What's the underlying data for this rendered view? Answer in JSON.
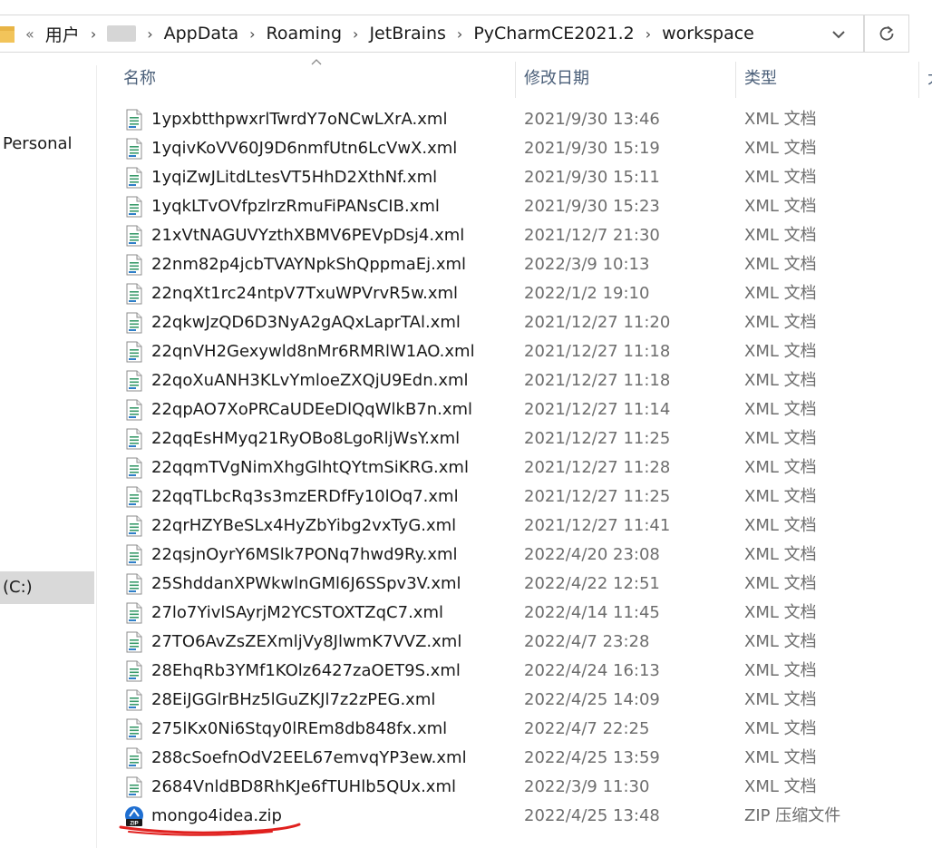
{
  "address_bar": {
    "overflow": "«",
    "crumbs": [
      "用户",
      "AppData",
      "Roaming",
      "JetBrains",
      "PyCharmCE2021.2",
      "workspace"
    ]
  },
  "nav": {
    "personal_label": "Personal",
    "drive_label": "(C:)"
  },
  "columns": {
    "name": "名称",
    "date": "修改日期",
    "type": "类型",
    "size": "大"
  },
  "files": [
    {
      "name": "1ypxbtthpwxrlTwrdY7oNCwLXrA.xml",
      "date": "2021/9/30 13:46",
      "type": "XML 文档",
      "icon": "xml-file-icon"
    },
    {
      "name": "1yqivKoVV60J9D6nmfUtn6LcVwX.xml",
      "date": "2021/9/30 15:19",
      "type": "XML 文档",
      "icon": "xml-file-icon"
    },
    {
      "name": "1yqiZwJLitdLtesVT5HhD2XthNf.xml",
      "date": "2021/9/30 15:11",
      "type": "XML 文档",
      "icon": "xml-file-icon"
    },
    {
      "name": "1yqkLTvOVfpzlrzRmuFiPANsCIB.xml",
      "date": "2021/9/30 15:23",
      "type": "XML 文档",
      "icon": "xml-file-icon"
    },
    {
      "name": "21xVtNAGUVYzthXBMV6PEVpDsj4.xml",
      "date": "2021/12/7 21:30",
      "type": "XML 文档",
      "icon": "xml-file-icon"
    },
    {
      "name": "22nm82p4jcbTVAYNpkShQppmaEj.xml",
      "date": "2022/3/9 10:13",
      "type": "XML 文档",
      "icon": "xml-file-icon"
    },
    {
      "name": "22nqXt1rc24ntpV7TxuWPVrvR5w.xml",
      "date": "2022/1/2 19:10",
      "type": "XML 文档",
      "icon": "xml-file-icon"
    },
    {
      "name": "22qkwJzQD6D3NyA2gAQxLaprTAl.xml",
      "date": "2021/12/27 11:20",
      "type": "XML 文档",
      "icon": "xml-file-icon"
    },
    {
      "name": "22qnVH2Gexywld8nMr6RMRlW1AO.xml",
      "date": "2021/12/27 11:18",
      "type": "XML 文档",
      "icon": "xml-file-icon"
    },
    {
      "name": "22qoXuANH3KLvYmloeZXQjU9Edn.xml",
      "date": "2021/12/27 11:18",
      "type": "XML 文档",
      "icon": "xml-file-icon"
    },
    {
      "name": "22qpAO7XoPRCaUDEeDlQqWlkB7n.xml",
      "date": "2021/12/27 11:14",
      "type": "XML 文档",
      "icon": "xml-file-icon"
    },
    {
      "name": "22qqEsHMyq21RyOBo8LgoRljWsY.xml",
      "date": "2021/12/27 11:25",
      "type": "XML 文档",
      "icon": "xml-file-icon"
    },
    {
      "name": "22qqmTVgNimXhgGlhtQYtmSiKRG.xml",
      "date": "2021/12/27 11:28",
      "type": "XML 文档",
      "icon": "xml-file-icon"
    },
    {
      "name": "22qqTLbcRq3s3mzERDfFy10lOq7.xml",
      "date": "2021/12/27 11:25",
      "type": "XML 文档",
      "icon": "xml-file-icon"
    },
    {
      "name": "22qrHZYBeSLx4HyZbYibg2vxTyG.xml",
      "date": "2021/12/27 11:41",
      "type": "XML 文档",
      "icon": "xml-file-icon"
    },
    {
      "name": "22qsjnOyrY6MSlk7PONq7hwd9Ry.xml",
      "date": "2022/4/20 23:08",
      "type": "XML 文档",
      "icon": "xml-file-icon"
    },
    {
      "name": "25ShddanXPWkwlnGMl6J6SSpv3V.xml",
      "date": "2022/4/22 12:51",
      "type": "XML 文档",
      "icon": "xml-file-icon"
    },
    {
      "name": "27lo7YivlSAyrjM2YCSTOXTZqC7.xml",
      "date": "2022/4/14 11:45",
      "type": "XML 文档",
      "icon": "xml-file-icon"
    },
    {
      "name": "27TO6AvZsZEXmljVy8JlwmK7VVZ.xml",
      "date": "2022/4/7 23:28",
      "type": "XML 文档",
      "icon": "xml-file-icon"
    },
    {
      "name": "28EhqRb3YMf1KOlz6427zaOET9S.xml",
      "date": "2022/4/24 16:13",
      "type": "XML 文档",
      "icon": "xml-file-icon"
    },
    {
      "name": "28EiJGGlrBHz5lGuZKJl7z2zPEG.xml",
      "date": "2022/4/25 14:09",
      "type": "XML 文档",
      "icon": "xml-file-icon"
    },
    {
      "name": "275lKx0Ni6Stqy0lREm8db848fx.xml",
      "date": "2022/4/7 22:25",
      "type": "XML 文档",
      "icon": "xml-file-icon"
    },
    {
      "name": "288cSoefnOdV2EEL67emvqYP3ew.xml",
      "date": "2022/4/25 13:59",
      "type": "XML 文档",
      "icon": "xml-file-icon"
    },
    {
      "name": "2684VnldBD8RhKJe6fTUHlb5QUx.xml",
      "date": "2022/3/9 11:30",
      "type": "XML 文档",
      "icon": "xml-file-icon"
    },
    {
      "name": "mongo4idea.zip",
      "date": "2022/4/25 13:48",
      "type": "ZIP 压缩文件",
      "icon": "zip-file-icon"
    }
  ],
  "colors": {
    "header_text": "#4c607a",
    "meta_text": "#6d6d6d",
    "annotation_red": "#e0201e",
    "selected_nav_bg": "#d9d9d9"
  }
}
